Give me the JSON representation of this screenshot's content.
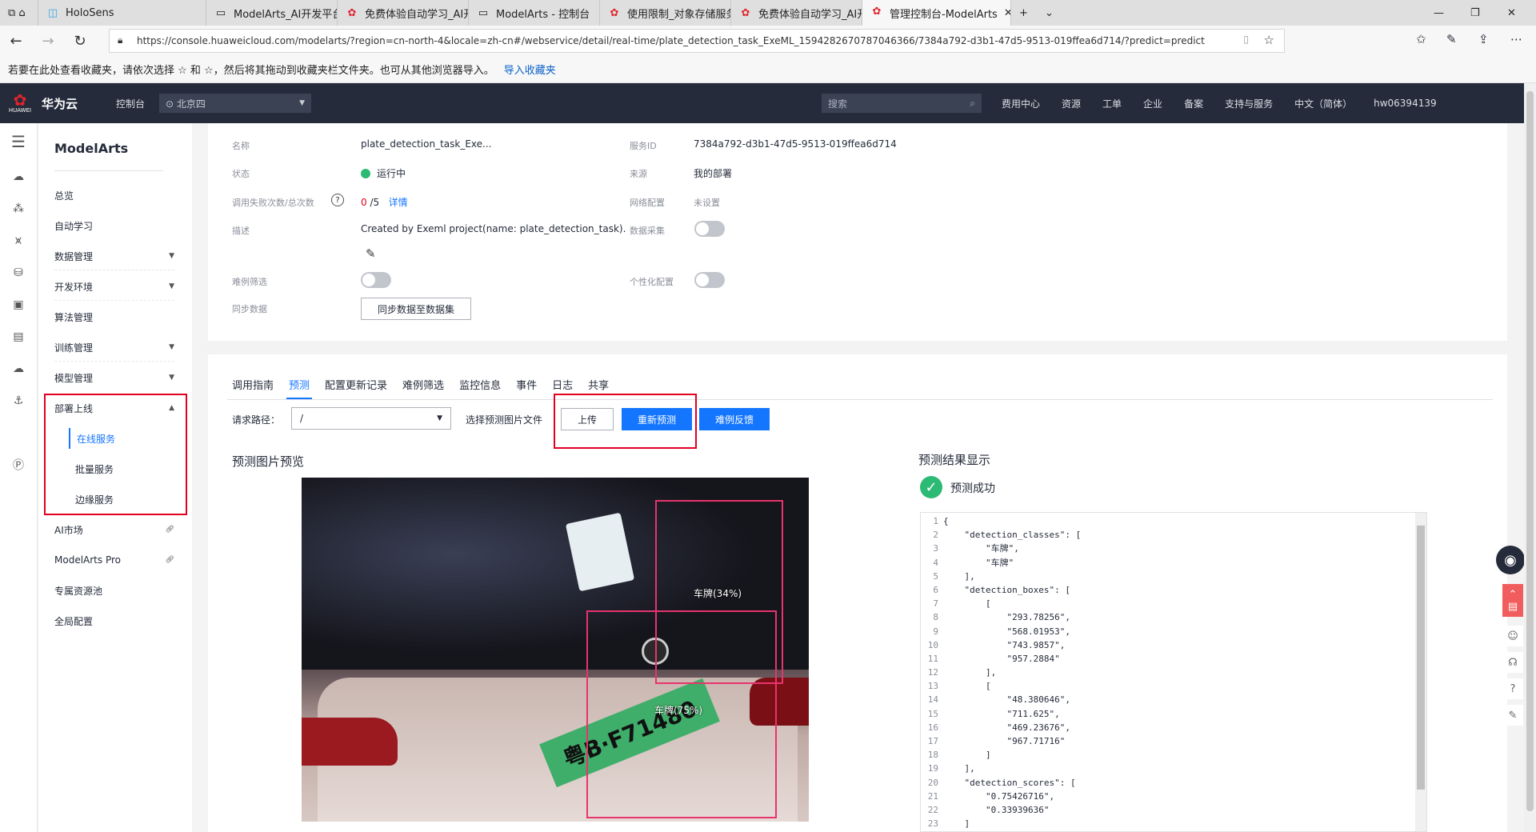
{
  "browser": {
    "tabs": [
      {
        "title": "HoloSens",
        "favicon": "holosens-icon"
      },
      {
        "title": "ModelArts_AI开发平台_机器",
        "favicon": "page-icon"
      },
      {
        "title": "免费体验自动学习_AI开发平",
        "favicon": "huawei-icon"
      },
      {
        "title": "ModelArts - 控制台",
        "favicon": "page-icon"
      },
      {
        "title": "使用限制_对象存储服务 OB",
        "favicon": "huawei-icon"
      },
      {
        "title": "免费体验自动学习_AI开发平",
        "favicon": "huawei-icon"
      },
      {
        "title": "管理控制台-ModelArts",
        "favicon": "huawei-icon"
      }
    ],
    "url": "https://console.huaweicloud.com/modelarts/?region=cn-north-4&locale=zh-cn#/webservice/detail/real-time/plate_detection_task_ExeML_1594282670787046366/7384a792-d3b1-47d5-9513-019ffea6d714/?predict=predict",
    "favorites_hint": "若要在此处查看收藏夹，请依次选择 ☆ 和 ☆，然后将其拖动到收藏夹栏文件夹。也可从其他浏览器导入。",
    "favorites_import": "导入收藏夹"
  },
  "topnav": {
    "logo_text": "HUAWEI",
    "brand": "华为云",
    "console": "控制台",
    "region": "北京四",
    "search_placeholder": "搜索",
    "items": [
      "费用中心",
      "资源",
      "工单",
      "企业",
      "备案",
      "支持与服务",
      "中文（简体）",
      "hw06394139"
    ]
  },
  "sidebar": {
    "title": "ModelArts",
    "items": [
      {
        "label": "总览"
      },
      {
        "label": "自动学习"
      },
      {
        "label": "数据管理"
      },
      {
        "label": "开发环境"
      },
      {
        "label": "算法管理"
      },
      {
        "label": "训练管理"
      },
      {
        "label": "模型管理"
      },
      {
        "label": "部署上线"
      }
    ],
    "sub_items": [
      "在线服务",
      "批量服务",
      "边缘服务"
    ],
    "bottom_items": [
      "AI市场",
      "ModelArts Pro",
      "专属资源池",
      "全局配置"
    ]
  },
  "info": {
    "name_label": "名称",
    "name_value": "plate_detection_task_Exe...",
    "service_id_label": "服务ID",
    "service_id_value": "7384a792-d3b1-47d5-9513-019ffea6d714",
    "status_label": "状态",
    "status_value": "运行中",
    "source_label": "来源",
    "source_value": "我的部署",
    "fail_label": "调用失败次数/总次数",
    "fail_value": "0",
    "total_value": "/5",
    "detail_link": "详情",
    "network_label": "网络配置",
    "network_value": "未设置",
    "desc_label": "描述",
    "desc_value": "Created by Exeml project(name: plate_detection_task).",
    "data_collect_label": "数据采集",
    "hard_filter_label": "难例筛选",
    "personal_label": "个性化配置",
    "sync_label": "同步数据",
    "sync_button": "同步数据至数据集"
  },
  "tabs": [
    "调用指南",
    "预测",
    "配置更新记录",
    "难例筛选",
    "监控信息",
    "事件",
    "日志",
    "共享"
  ],
  "predict": {
    "path_label": "请求路径：",
    "path_value": "/",
    "file_label": "选择预测图片文件",
    "upload_button": "上传",
    "repredict_button": "重新预测",
    "feedback_button": "难例反馈",
    "preview_title": "预测图片预览",
    "result_title": "预测结果显示",
    "success_text": "预测成功",
    "detections": [
      {
        "label": "车牌(34%)"
      },
      {
        "label": "车牌(75%)"
      }
    ],
    "plate_text": "粤B·F71480"
  },
  "code_lines": [
    {
      "n": "1",
      "t": "{"
    },
    {
      "n": "2",
      "t": "    \"detection_classes\": ["
    },
    {
      "n": "3",
      "t": "        \"车牌\","
    },
    {
      "n": "4",
      "t": "        \"车牌\""
    },
    {
      "n": "5",
      "t": "    ],"
    },
    {
      "n": "6",
      "t": "    \"detection_boxes\": ["
    },
    {
      "n": "7",
      "t": "        ["
    },
    {
      "n": "8",
      "t": "            \"293.78256\","
    },
    {
      "n": "9",
      "t": "            \"568.01953\","
    },
    {
      "n": "10",
      "t": "            \"743.9857\","
    },
    {
      "n": "11",
      "t": "            \"957.2884\""
    },
    {
      "n": "12",
      "t": "        ],"
    },
    {
      "n": "13",
      "t": "        ["
    },
    {
      "n": "14",
      "t": "            \"48.380646\","
    },
    {
      "n": "15",
      "t": "            \"711.625\","
    },
    {
      "n": "16",
      "t": "            \"469.23676\","
    },
    {
      "n": "17",
      "t": "            \"967.71716\""
    },
    {
      "n": "18",
      "t": "        ]"
    },
    {
      "n": "19",
      "t": "    ],"
    },
    {
      "n": "20",
      "t": "    \"detection_scores\": ["
    },
    {
      "n": "21",
      "t": "        \"0.75426716\","
    },
    {
      "n": "22",
      "t": "        \"0.33939636\""
    },
    {
      "n": "23",
      "t": "    ]"
    }
  ],
  "colors": {
    "accent": "#1476ff",
    "topnav_bg": "#252b3a",
    "highlight_box": "#e1001f",
    "detection_box": "#e8336d",
    "success": "#2dba74"
  }
}
